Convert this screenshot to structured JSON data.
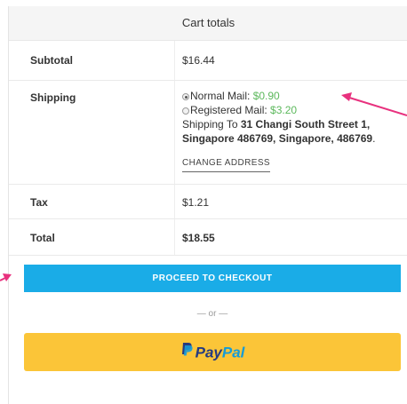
{
  "cart": {
    "title": "Cart totals",
    "subtotal": {
      "label": "Subtotal",
      "value": "$16.44"
    },
    "shipping": {
      "label": "Shipping",
      "options": [
        {
          "name": "Normal Mail:",
          "price": "$0.90",
          "selected": true
        },
        {
          "name": "Registered Mail:",
          "price": "$3.20",
          "selected": false
        }
      ],
      "shipping_to_prefix": "Shipping To",
      "address": "31 Changi South Street 1, Singapore 486769, Singapore, 486769",
      "change_address_label": "CHANGE ADDRESS"
    },
    "tax": {
      "label": "Tax",
      "value": "$1.21"
    },
    "total": {
      "label": "Total",
      "value": "$18.55"
    }
  },
  "checkout": {
    "button_label": "PROCEED TO CHECKOUT",
    "or_text": "— or —"
  },
  "paypal": {
    "pay": "Pay",
    "pal": "Pal"
  },
  "colors": {
    "price_green": "#5cb85c",
    "checkout_blue": "#1aace7",
    "paypal_yellow": "#fbc538",
    "annotation_pink": "#e8317e"
  }
}
